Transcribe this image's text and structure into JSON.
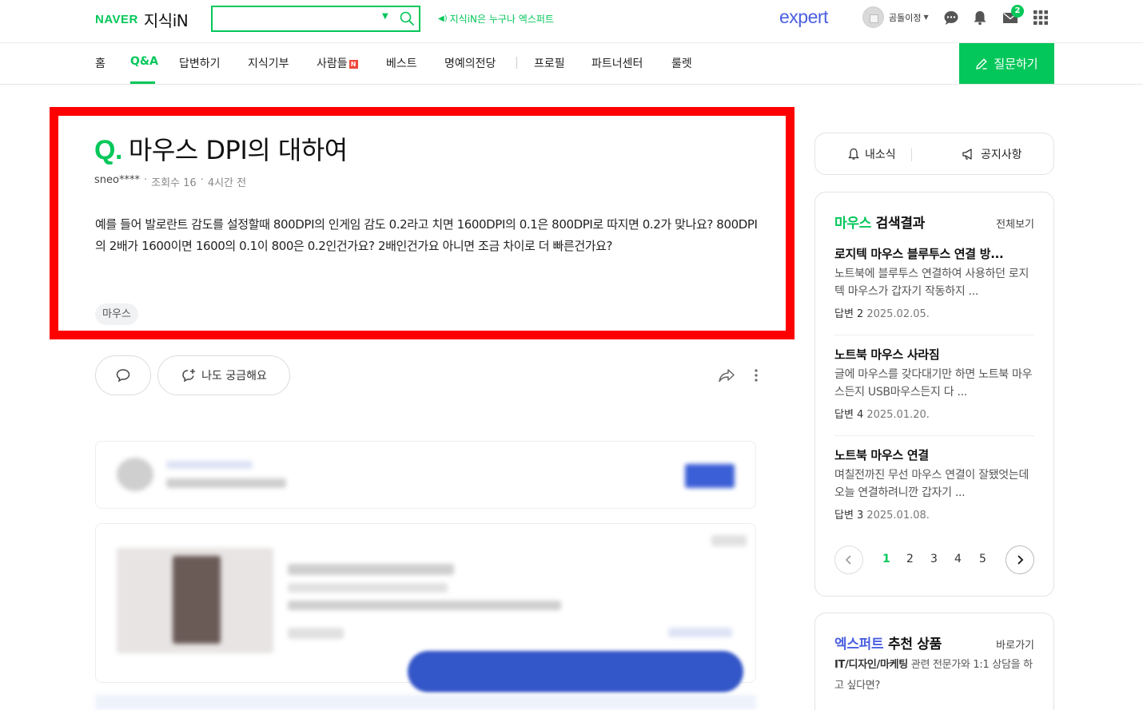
{
  "header": {
    "logo_naver": "NAVER",
    "logo_kin": "지식iN",
    "search_placeholder": "",
    "promo_text": "지식iN은 누구나 엑스퍼트",
    "expert_logo": "expert",
    "user_name": "곰돌이정",
    "notification_count": "2"
  },
  "nav": {
    "items": [
      "홈",
      "Q&A",
      "답변하기",
      "지식기부",
      "사람들",
      "베스트",
      "명예의전당",
      "프로필",
      "파트너센터",
      "룰렛"
    ],
    "new_badge": "N",
    "ask_button": "질문하기"
  },
  "question": {
    "q_mark": "Q.",
    "title": "마우스 DPI의 대하여",
    "author": "sneo****",
    "views": "조회수 16",
    "time": "4시간 전",
    "body": "예를 들어 발로란트 감도를 설정할때 800DPI의 인게임 감도 0.2라고 치면 1600DPI의 0.1은 800DPI로 따지면 0.2가 맞나요? 800DPI의 2배가 1600이면 1600의 0.1이 800은 0.2인건가요? 2배인건가요 아니면 조금 차이로 더 빠른건가요?",
    "tag": "마우스",
    "curious_button": "나도 궁금해요"
  },
  "sidebar": {
    "tabs": [
      "내소식",
      "공지사항"
    ],
    "search_card": {
      "keyword": "마우스",
      "title_suffix": " 검색결과",
      "more": "전체보기",
      "results": [
        {
          "title": "로지텍 마우스 블루투스 연결 방...",
          "desc": "노트북에 블루투스 연결하여 사용하던 로지텍 마우스가 갑자기 작동하지 ...",
          "answers": "답변 2",
          "date": "2025.02.05."
        },
        {
          "title": "노트북 마우스 사라짐",
          "desc": "글에 마우스를 갖다대기만 하면 노트북 마우스든지 USB마우스든지 다 ...",
          "answers": "답변 4",
          "date": "2025.01.20."
        },
        {
          "title": "노트북 마우스 연결",
          "desc": "며칠전까진 무선 마우스 연결이 잘됐엇는데 오늘 연결하려니깐 갑자기 ...",
          "answers": "답변 3",
          "date": "2025.01.08."
        }
      ],
      "pages": [
        "1",
        "2",
        "3",
        "4",
        "5"
      ],
      "current_page": "1"
    },
    "expert_card": {
      "title_hl": "엑스퍼트",
      "title_rest": " 추천 상품",
      "more": "바로가기",
      "desc_bold": "IT/디자인/마케팅",
      "desc_rest": " 관련 전문가와 1:1 상담을 하고 싶다면?"
    }
  },
  "colors": {
    "brand_green": "#03c75a",
    "expert_blue": "#4a5fe0",
    "highlight_red": "#ff0000"
  }
}
